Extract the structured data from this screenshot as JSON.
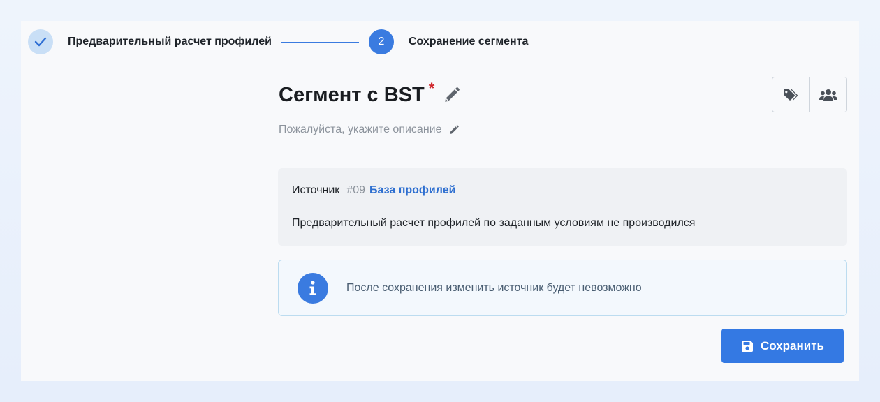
{
  "stepper": {
    "step1": {
      "label": "Предварительный расчет профилей",
      "state": "done"
    },
    "step2": {
      "number": "2",
      "label": "Сохранение сегмента",
      "state": "active"
    }
  },
  "segment": {
    "title": "Сегмент с BST",
    "required_mark": "*",
    "description_placeholder": "Пожалуйста, укажите описание"
  },
  "toolbar": {
    "icons": [
      "tags-icon",
      "users-icon"
    ]
  },
  "source": {
    "label": "Источник",
    "id": "#09",
    "name": "База профилей",
    "status": "Предварительный расчет профилей по заданным условиям не производился"
  },
  "info": {
    "icon": "info-icon",
    "text": "После сохранения изменить источник будет невозможно"
  },
  "actions": {
    "save_label": "Сохранить"
  },
  "colors": {
    "accent": "#3a7be0",
    "link": "#2e6fd0",
    "required": "#d0262b",
    "step_done_bg": "#c9dff6"
  }
}
